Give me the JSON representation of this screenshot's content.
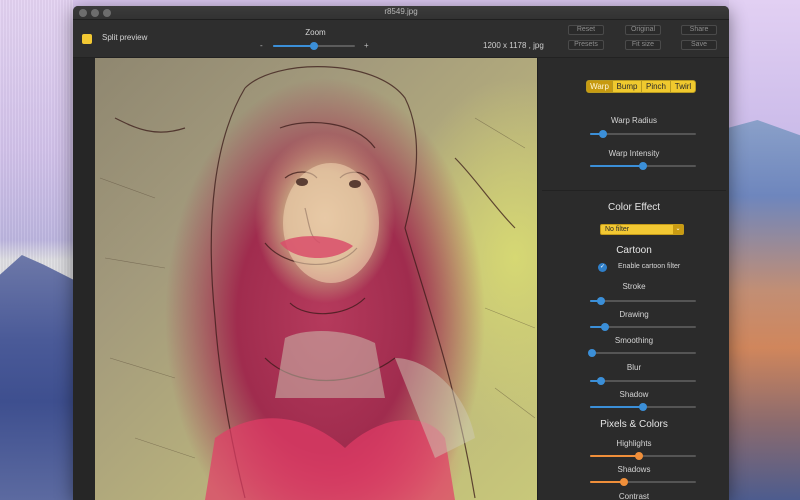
{
  "window": {
    "title": "r8549.jpg"
  },
  "toolbar": {
    "split_preview_label": "Split preview",
    "zoom_label": "Zoom",
    "zoom_minus": "-",
    "zoom_plus": "+",
    "zoom_value": 0.5,
    "image_info": "1200 x 1178 , jpg",
    "buttons": {
      "reset": "Reset",
      "original": "Original",
      "share": "Share",
      "presets": "Presets",
      "fit_size": "Fit size",
      "save": "Save"
    }
  },
  "panel": {
    "segments": [
      "Warp",
      "Bump",
      "Pinch",
      "Twirl"
    ],
    "selected_segment": "Warp",
    "warp_radius": {
      "label": "Warp Radius",
      "value": 0.12
    },
    "warp_intensity": {
      "label": "Warp Intensity",
      "value": 0.5
    },
    "color_effect": {
      "heading": "Color Effect",
      "selected_filter": "No filter",
      "arrow": "⌄"
    },
    "cartoon": {
      "heading": "Cartoon",
      "enable_label": "Enable cartoon filter",
      "enabled": true,
      "check_glyph": "✓",
      "stroke": {
        "label": "Stroke",
        "value": 0.1
      },
      "drawing": {
        "label": "Drawing",
        "value": 0.14
      },
      "smoothing": {
        "label": "Smoothing",
        "value": 0.02
      },
      "blur": {
        "label": "Blur",
        "value": 0.1
      },
      "shadow": {
        "label": "Shadow",
        "value": 0.5
      }
    },
    "pixels_colors": {
      "heading": "Pixels & Colors",
      "highlights": {
        "label": "Highlights",
        "value": 0.46
      },
      "shadows": {
        "label": "Shadows",
        "value": 0.32
      },
      "contrast": {
        "label": "Contrast"
      }
    }
  },
  "colors": {
    "accent_yellow": "#f2c833",
    "slider_blue": "#3b8fd8",
    "slider_orange": "#f08f3a",
    "panel_bg": "#2b2b2b"
  }
}
